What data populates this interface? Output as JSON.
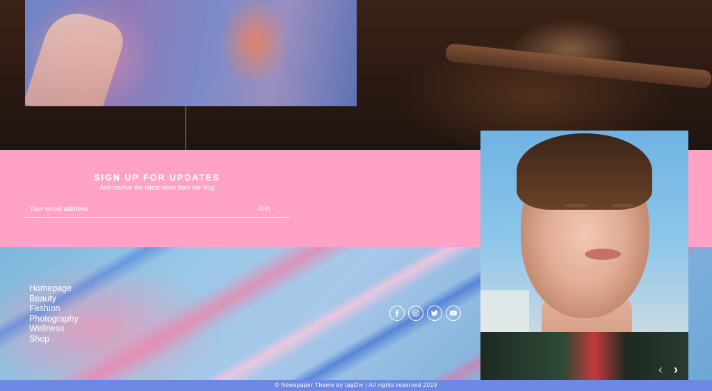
{
  "signup": {
    "title": "SIGN UP FOR UPDATES",
    "subtitle": "And receive the latest news from our blog",
    "email_placeholder": "Your email address",
    "join_label": "Join -"
  },
  "footer": {
    "nav": [
      "Homepage",
      "Beauty",
      "Fashion",
      "Photography",
      "Wellness",
      "Shop"
    ],
    "socials": [
      "facebook-icon",
      "instagram-icon",
      "twitter-icon",
      "youtube-icon"
    ]
  },
  "slider": {
    "prev": "‹",
    "next": "›"
  },
  "copyright": "© Newspaper Theme by tagDiv | All rights reserved 2019",
  "colors": {
    "signup_bg": "#ffa2c6",
    "copyright_bg": "#6c8ae5"
  }
}
